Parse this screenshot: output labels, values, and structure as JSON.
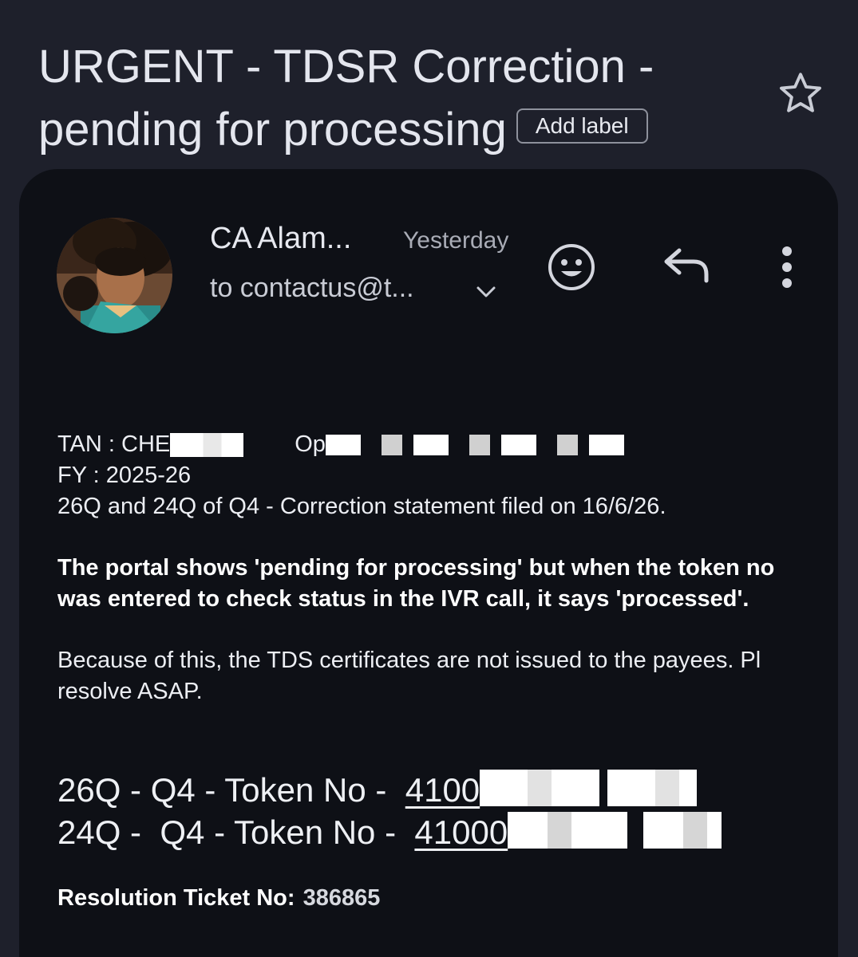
{
  "header": {
    "subject": "URGENT - TDSR Correction - pending for processing",
    "add_label": "Add label",
    "star_icon": "star-outline-icon"
  },
  "message": {
    "sender": "CA Alam...",
    "date": "Yesterday",
    "recipient": "to contactus@t...",
    "expand_icon": "chevron-down-icon",
    "actions": {
      "emoji_icon": "add-reaction-icon",
      "reply_icon": "reply-icon",
      "more_icon": "more-vert-icon"
    }
  },
  "body": {
    "tan_prefix": "TAN : CHE",
    "tan_fragment": "Op",
    "fy": "FY : 2025-26",
    "correction_line": "26Q and 24Q of Q4 - Correction statement filed on 16/6/26.",
    "bold_paragraph": "The portal shows 'pending for processing' but when the token no was entered to check status in the IVR call, it says 'processed'.",
    "paragraph2": "Because of this, the TDS certificates are not issued to the payees. Pl resolve ASAP.",
    "token1_label": "26Q - Q4 - Token No -  ",
    "token1_value": "4100",
    "token2_label": "24Q -  Q4 - Token No -  ",
    "token2_value": "41000",
    "ticket_label": "Resolution Ticket No:",
    "ticket_value": "386865"
  },
  "colors": {
    "background": "#1e202b",
    "card": "#0e1016",
    "text": "#e6e8ef",
    "muted": "#a9acb6"
  }
}
